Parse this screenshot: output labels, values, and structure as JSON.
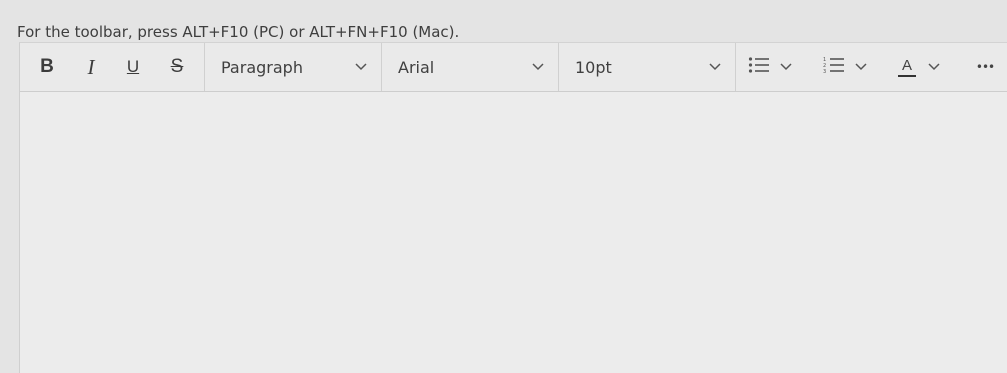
{
  "hint": {
    "text": "For the toolbar, press ALT+F10 (PC) or ALT+FN+F10 (Mac)."
  },
  "toolbar": {
    "bold_label": "B",
    "italic_label": "I",
    "underline_label": "U",
    "strike_label": "S",
    "block_format": "Paragraph",
    "font_family": "Arial",
    "font_size": "10pt",
    "text_color_label": "A",
    "more_label": "•••",
    "icons": {
      "bullet_list": "bullet-list-icon",
      "numbered_list": "numbered-list-icon",
      "chevron": "chevron-down-icon"
    }
  },
  "editor": {
    "content": ""
  }
}
